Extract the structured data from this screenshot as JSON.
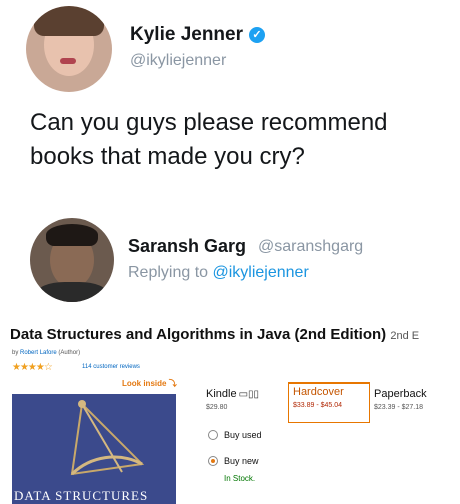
{
  "tweet": {
    "name": "Kylie Jenner",
    "handle": "@ikyliejenner",
    "text": "Can you guys please recommend books that made you cry?"
  },
  "reply": {
    "name": "Saransh Garg",
    "handle": "@saranshgarg",
    "replying_prefix": "Replying to",
    "replying_to": "@ikyliejenner"
  },
  "product": {
    "title": "Data Structures and Algorithms in Java (2nd Edition)",
    "title_suffix": "2nd E",
    "byline_prefix": "by",
    "author": "Robert Lafore",
    "author_role": "(Author)",
    "stars": "★★★★☆",
    "reviews": "114 customer reviews",
    "look_inside": "Look inside",
    "cover_text": "DATA STRUCTURES",
    "formats": [
      {
        "label": "Kindle",
        "price": "$29.80"
      },
      {
        "label": "Hardcover",
        "price": "$33.89 - $45.04"
      },
      {
        "label": "Paperback",
        "price": "$23.39 - $27.18"
      }
    ],
    "options": [
      {
        "label": "Buy used",
        "selected": false
      },
      {
        "label": "Buy new",
        "selected": true
      }
    ],
    "stock": "In Stock."
  },
  "colors": {
    "link": "#1b95e0",
    "verified": "#1da1f2",
    "amazon_orange": "#e47911"
  }
}
